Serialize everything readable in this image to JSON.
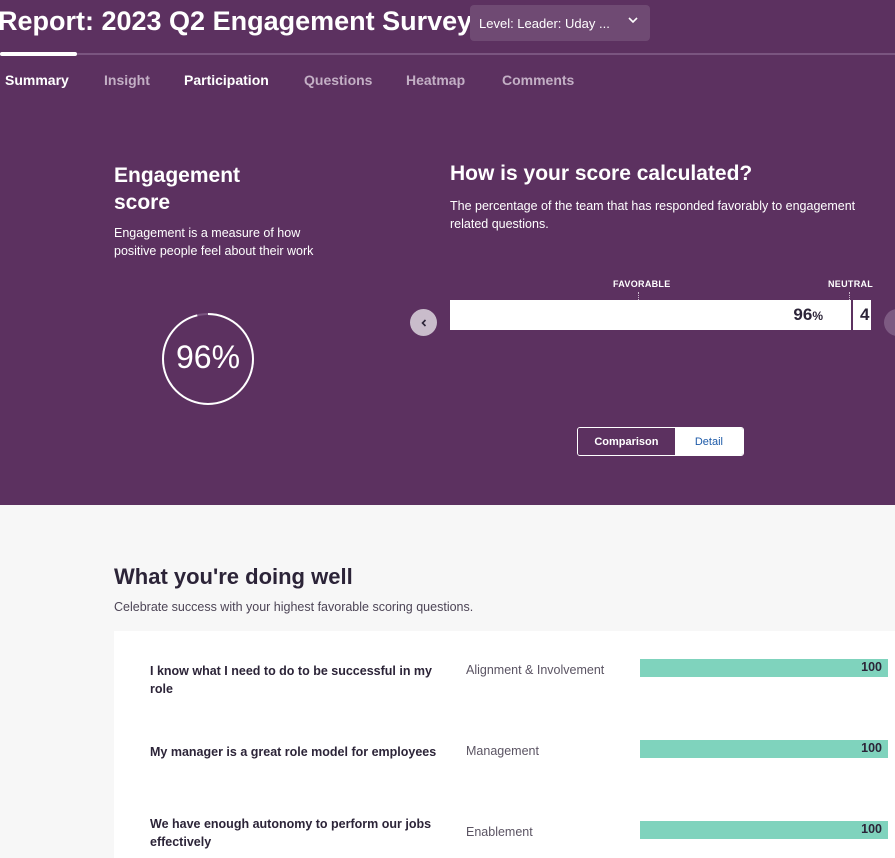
{
  "header": {
    "report_title": "Report: 2023 Q2 Engagement Survey",
    "level_dropdown": "Level: Leader: Uday ..."
  },
  "tabs": [
    {
      "label": "Summary",
      "active": true
    },
    {
      "label": "Insight",
      "active": false
    },
    {
      "label": "Participation",
      "active": false
    },
    {
      "label": "Questions",
      "active": false
    },
    {
      "label": "Heatmap",
      "active": false
    },
    {
      "label": "Comments",
      "active": false
    }
  ],
  "engagement": {
    "title": "Engagement score",
    "description": "Engagement is a measure of how positive people feel about their work",
    "score_text": "96%",
    "score_fraction": 0.96
  },
  "calculation": {
    "title": "How is your score calculated?",
    "description": "The percentage of the team that has responded favorably to engagement related questions.",
    "favorable_label": "FAVORABLE",
    "neutral_label": "NEUTRAL",
    "favorable_value": "96",
    "favorable_unit": "%",
    "neutral_value_partial": "4"
  },
  "view_toggle": {
    "comparison": "Comparison",
    "detail": "Detail"
  },
  "doing_well": {
    "title": "What you're doing well",
    "subtitle": "Celebrate success with your highest favorable scoring questions.",
    "rows": [
      {
        "question": "I know what I need to do to be successful in my role",
        "category": "Alignment & Involvement",
        "score": "100"
      },
      {
        "question": "My manager is a great role model for employees",
        "category": "Management",
        "score": "100"
      },
      {
        "question": "We have enough autonomy to perform our jobs effectively",
        "category": "Enablement",
        "score": "100"
      }
    ]
  },
  "colors": {
    "hero_bg": "#5c3160",
    "bar_fill": "#7fd3bd",
    "link_blue": "#1d5aa8"
  }
}
